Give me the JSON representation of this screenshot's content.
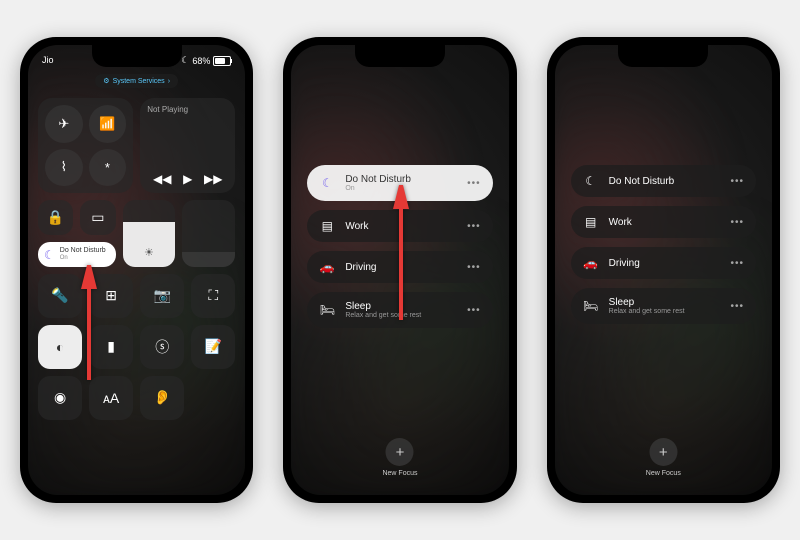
{
  "status": {
    "carrier": "Jio",
    "battery_pct": "68%",
    "moon": "☾"
  },
  "pill": {
    "icon": "⚙",
    "text": "System Services",
    "chev": "›"
  },
  "cc": {
    "not_playing": "Not Playing",
    "focus_label": "Do Not Disturb",
    "focus_sub": "On",
    "brightness_pct": 55,
    "volume_pct": 0
  },
  "focus_list": [
    {
      "icon": "☾",
      "label": "Do Not Disturb",
      "sub": "On"
    },
    {
      "icon": "▤",
      "label": "Work",
      "sub": ""
    },
    {
      "icon": "🚗",
      "label": "Driving",
      "sub": ""
    },
    {
      "icon": "🛏",
      "label": "Sleep",
      "sub": "Relax and get some rest"
    }
  ],
  "new_focus": "New Focus",
  "colors": {
    "accent": "#7b68ee",
    "arrow": "#e53935"
  }
}
